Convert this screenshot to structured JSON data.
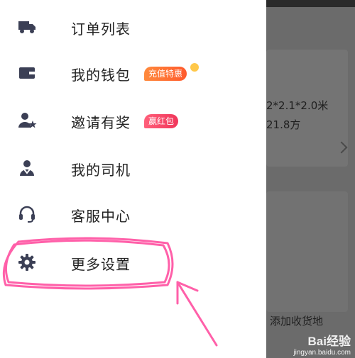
{
  "drawer": {
    "items": [
      {
        "label": "订单列表",
        "icon": "truck-icon"
      },
      {
        "label": "我的钱包",
        "icon": "wallet-icon",
        "badge": "充值特惠"
      },
      {
        "label": "邀请有奖",
        "icon": "user-star-icon",
        "badge": "赢红包"
      },
      {
        "label": "我的司机",
        "icon": "driver-icon"
      },
      {
        "label": "客服中心",
        "icon": "headset-icon"
      },
      {
        "label": "更多设置",
        "icon": "gear-icon"
      }
    ]
  },
  "background": {
    "line1": "2*2.1*2.0米",
    "line2": "21.8方",
    "line3": "添加收货地"
  },
  "watermark": {
    "logo": "Bai经验",
    "url": "jingyan.baidu.com"
  },
  "colors": {
    "icon": "#3b3f55",
    "badge_orange": "#ff6a2c",
    "badge_red": "#f0365a",
    "highlight": "#ff4fa0"
  }
}
